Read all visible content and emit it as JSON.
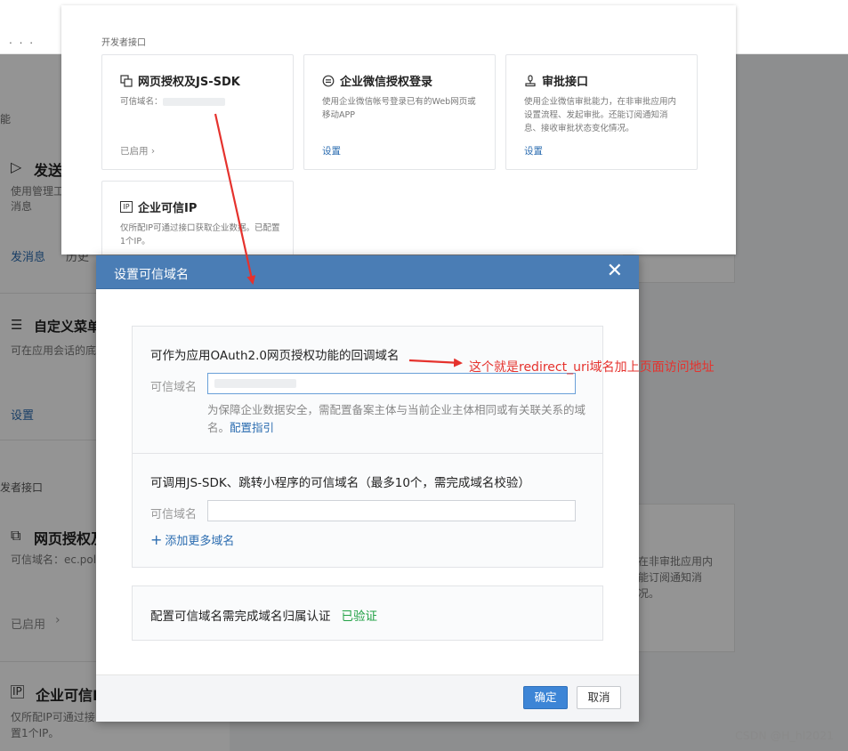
{
  "topbar": {
    "dots": ". . ."
  },
  "background": {
    "left_items": [
      {
        "icon": "send-icon",
        "title": "发送",
        "desc": "使用管理工",
        "desc2": "消息",
        "action1": "发消息",
        "action2": "历史"
      },
      {
        "icon": "menu-icon",
        "title": "自定义菜单",
        "desc": "可在应用会话的底",
        "action1": "设置"
      }
    ],
    "section_label": "发者接口",
    "left_cards": [
      {
        "title": "网页授权及",
        "desc": "可信域名：ec.poly",
        "action": "已启用"
      },
      {
        "title": "企业可信I",
        "desc": "仅所配IP可通过接",
        "desc2": "置1个IP。"
      }
    ],
    "right_text": [
      "在非审批应用内",
      "能订阅通知消",
      "况。"
    ],
    "label_ability": "能"
  },
  "dev_panel": {
    "title": "开发者接口",
    "cards": [
      {
        "icon": "web-auth-icon",
        "name": "网页授权及JS-SDK",
        "desc": "可信域名：",
        "action": "已启用 ›"
      },
      {
        "icon": "wechat-login-icon",
        "name": "企业微信授权登录",
        "desc": "使用企业微信帐号登录已有的Web网页或移动APP",
        "action": "设置"
      },
      {
        "icon": "approval-icon",
        "name": "审批接口",
        "desc": "使用企业微信审批能力，在非审批应用内设置流程、发起审批。还能订阅通知消息、接收审批状态变化情况。",
        "action": "设置"
      },
      {
        "icon": "ip-icon",
        "name": "企业可信IP",
        "desc": "仅所配IP可通过接口获取企业数据。已配置1个IP。",
        "action": ""
      }
    ]
  },
  "dialog": {
    "title": "设置可信域名",
    "close": "✕",
    "section1": {
      "heading": "可作为应用OAuth2.0网页授权功能的回调域名",
      "label": "可信域名",
      "value": "",
      "hint": "为保障企业数据安全，需配置备案主体与当前企业主体相同或有关联关系的域名。",
      "hint_link": "配置指引"
    },
    "section2": {
      "heading": "可调用JS-SDK、跳转小程序的可信域名（最多10个，需完成域名校验）",
      "label": "可信域名",
      "value": "",
      "add_more": "添加更多域名"
    },
    "section3": {
      "text": "配置可信域名需完成域名归属认证",
      "status": "已验证"
    },
    "buttons": {
      "ok": "确定",
      "cancel": "取消"
    }
  },
  "annotation": {
    "text": "这个就是redirect_uri域名加上页面访问地址",
    "color": "#e5322d"
  },
  "watermark": "CSDN @H_hl2021"
}
